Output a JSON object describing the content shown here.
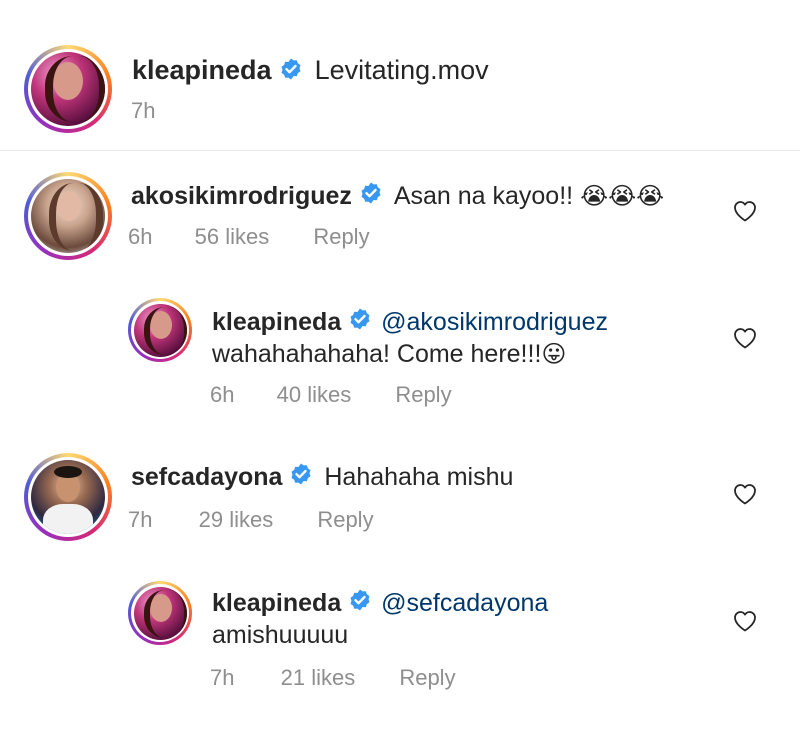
{
  "post": {
    "username": "kleapineda",
    "caption": "Levitating.mov",
    "time": "7h"
  },
  "comments": [
    {
      "username": "akosikimrodriguez",
      "text": "Asan na kayoo!!",
      "emoji": "😭😭😭",
      "time": "6h",
      "likes": "56 likes",
      "reply": "Reply",
      "replies": [
        {
          "username": "kleapineda",
          "mention": "@akosikimrodriguez",
          "text": "wahahahahaha! Come here!!!",
          "emoji": "😛",
          "time": "6h",
          "likes": "40 likes",
          "reply": "Reply"
        }
      ]
    },
    {
      "username": "sefcadayona",
      "text": "Hahahaha mishu",
      "time": "7h",
      "likes": "29 likes",
      "reply": "Reply",
      "replies": [
        {
          "username": "kleapineda",
          "mention": "@sefcadayona",
          "text": "amishuuuuu",
          "time": "7h",
          "likes": "21 likes",
          "reply": "Reply"
        }
      ]
    }
  ],
  "icons": {
    "verified": "verified-badge-icon",
    "heart": "heart-outline-icon"
  },
  "colors": {
    "verified_blue": "#3897f0",
    "muted": "#8e8e8e",
    "mention": "#00376b"
  }
}
